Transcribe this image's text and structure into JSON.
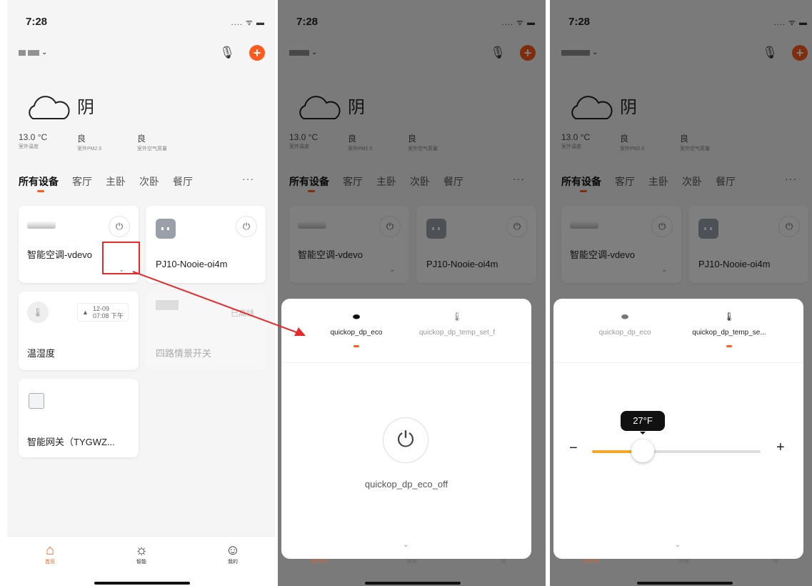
{
  "status": {
    "time": "7:28",
    "signal": "....",
    "icons": [
      "wifi-icon",
      "battery-icon"
    ]
  },
  "header": {
    "mic_icon": "mic-icon",
    "add_icon": "plus-circle-icon",
    "accent": "#ff5a1f"
  },
  "weather": {
    "condition": "阴",
    "icon": "cloud-icon",
    "stats": [
      {
        "value": "13.0 °C",
        "label": "室外温度"
      },
      {
        "value": "良",
        "label": "室外PM2.5"
      },
      {
        "value": "良",
        "label": "室外空气质量"
      }
    ]
  },
  "rooms": {
    "items": [
      "所有设备",
      "客厅",
      "主卧",
      "次卧",
      "餐厅"
    ],
    "active": "所有设备",
    "more": "···"
  },
  "devices": {
    "ac": {
      "name": "智能空调-vdevo"
    },
    "plug": {
      "name": "PJ10-Nooie-oi4m"
    },
    "sensor": {
      "name": "温湿度",
      "date": "12-09",
      "time": "07:08 下午"
    },
    "switch": {
      "name": "四路情景开关",
      "status": "已离线"
    },
    "gateway": {
      "name": "智能网关（TYGWZ..."
    }
  },
  "tabbar": {
    "home": "首页",
    "smart": "智能",
    "me": "我的"
  },
  "tabbar_dim": {
    "home": "我的家",
    "smart": "智能",
    "me": "我"
  },
  "sheet_eco": {
    "tab1": "quickop_dp_eco",
    "tab2": "quickop_dp_temp_set_f",
    "power_label": "quickop_dp_eco_off"
  },
  "sheet_temp": {
    "tab1": "quickop_dp_eco",
    "tab2": "quickop_dp_temp_se...",
    "value_label": "27°F",
    "slider_fraction": 0.3,
    "minus": "−",
    "plus": "+"
  }
}
